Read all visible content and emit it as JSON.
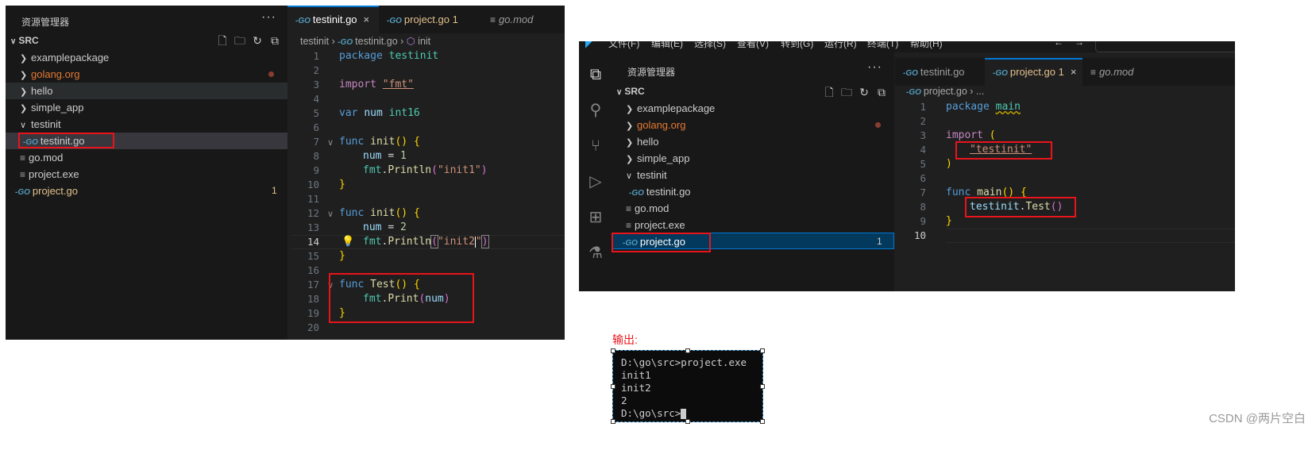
{
  "left": {
    "explorer_title": "资源管理器",
    "more": "···",
    "src": "SRC",
    "tree": [
      {
        "label": "examplepackage",
        "kind": "folder"
      },
      {
        "label": "golang.org",
        "kind": "folder"
      },
      {
        "label": "hello",
        "kind": "folder"
      },
      {
        "label": "simple_app",
        "kind": "folder"
      },
      {
        "label": "testinit",
        "kind": "folder-open"
      },
      {
        "label": "testinit.go",
        "kind": "go"
      },
      {
        "label": "go.mod",
        "kind": "file"
      },
      {
        "label": "project.exe",
        "kind": "file"
      },
      {
        "label": "project.go",
        "kind": "go"
      }
    ],
    "project_badge": "1",
    "tabs": [
      {
        "label": "testinit.go",
        "close": "×"
      },
      {
        "label": "project.go",
        "badge": "1"
      },
      {
        "label": "go.mod"
      }
    ],
    "breadcrumb": {
      "a": "testinit",
      "b": "testinit.go",
      "c": "init"
    },
    "line_numbers": [
      "1",
      "2",
      "3",
      "4",
      "5",
      "6",
      "7",
      "8",
      "9",
      "10",
      "11",
      "12",
      "13",
      "14",
      "15",
      "16",
      "17",
      "18",
      "19",
      "20"
    ]
  },
  "right": {
    "menu": [
      "文件(F)",
      "编辑(E)",
      "选择(S)",
      "查看(V)",
      "转到(G)",
      "运行(R)",
      "终端(T)",
      "帮助(H)"
    ],
    "explorer_title": "资源管理器",
    "more": "···",
    "src": "SRC",
    "tree": [
      {
        "label": "examplepackage"
      },
      {
        "label": "golang.org"
      },
      {
        "label": "hello"
      },
      {
        "label": "simple_app"
      },
      {
        "label": "testinit"
      },
      {
        "label": "testinit.go"
      },
      {
        "label": "go.mod"
      },
      {
        "label": "project.exe"
      },
      {
        "label": "project.go"
      }
    ],
    "project_badge": "1",
    "tabs": [
      {
        "label": "testinit.go"
      },
      {
        "label": "project.go",
        "badge": "1",
        "close": "×"
      },
      {
        "label": "go.mod"
      }
    ],
    "breadcrumb": {
      "a": "project.go",
      "b": "..."
    },
    "line_numbers": [
      "1",
      "2",
      "3",
      "4",
      "5",
      "6",
      "7",
      "8",
      "9",
      "10"
    ]
  },
  "output": {
    "label": "输出:",
    "lines": [
      "D:\\go\\src>project.exe",
      "init1",
      "init2",
      "2",
      "D:\\go\\src>"
    ]
  },
  "watermark": "CSDN @两片空白",
  "colors": {
    "highlight_box": "#e8141b",
    "accent": "#0078d4"
  }
}
